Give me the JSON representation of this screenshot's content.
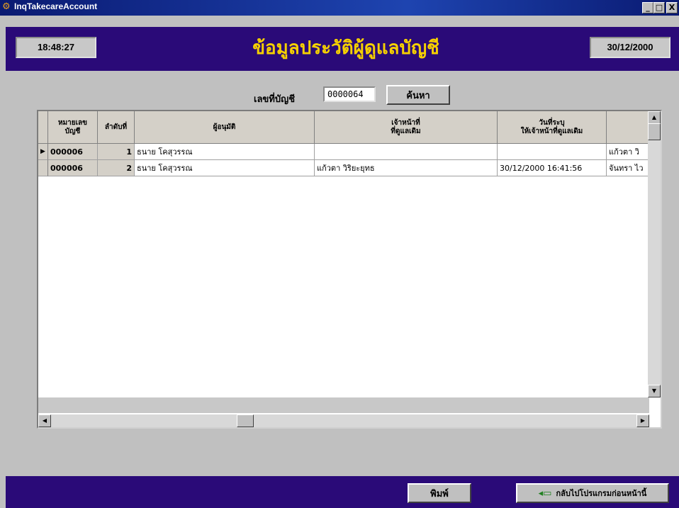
{
  "window": {
    "title": "InqTakecareAccount",
    "min": "_",
    "max": "□",
    "close": "X"
  },
  "header": {
    "time": "18:48:27",
    "title": "ข้อมูลประวัติผู้ดูแลบัญชี",
    "date": "30/12/2000"
  },
  "search": {
    "label": "เลขที่บัญชี",
    "value": "0000064",
    "button": "ค้นหา"
  },
  "grid": {
    "columns": [
      "หมายเลข\nบัญชี",
      "ลำดับที่",
      "ผู้อนุมัติ",
      "เจ้าหน้าที่\nที่ดูแลเดิม",
      "วันที่ระบุ\nให้เจ้าหน้าที่ดูแลเดิม",
      ""
    ],
    "rows": [
      {
        "indicator": "▶",
        "cells": [
          "000006",
          "1",
          "ธนาย โคสุวรรณ",
          "",
          "",
          "แก้วตา วิ"
        ]
      },
      {
        "indicator": "",
        "cells": [
          "000006",
          "2",
          "ธนาย โคสุวรรณ",
          "แก้วตา วิริยะยุทธ",
          "30/12/2000 16:41:56",
          "จันทรา ไว"
        ]
      }
    ]
  },
  "footer": {
    "print": "พิมพ์",
    "back": "กลับไปโปรแกรมก่อนหน้านี้"
  }
}
